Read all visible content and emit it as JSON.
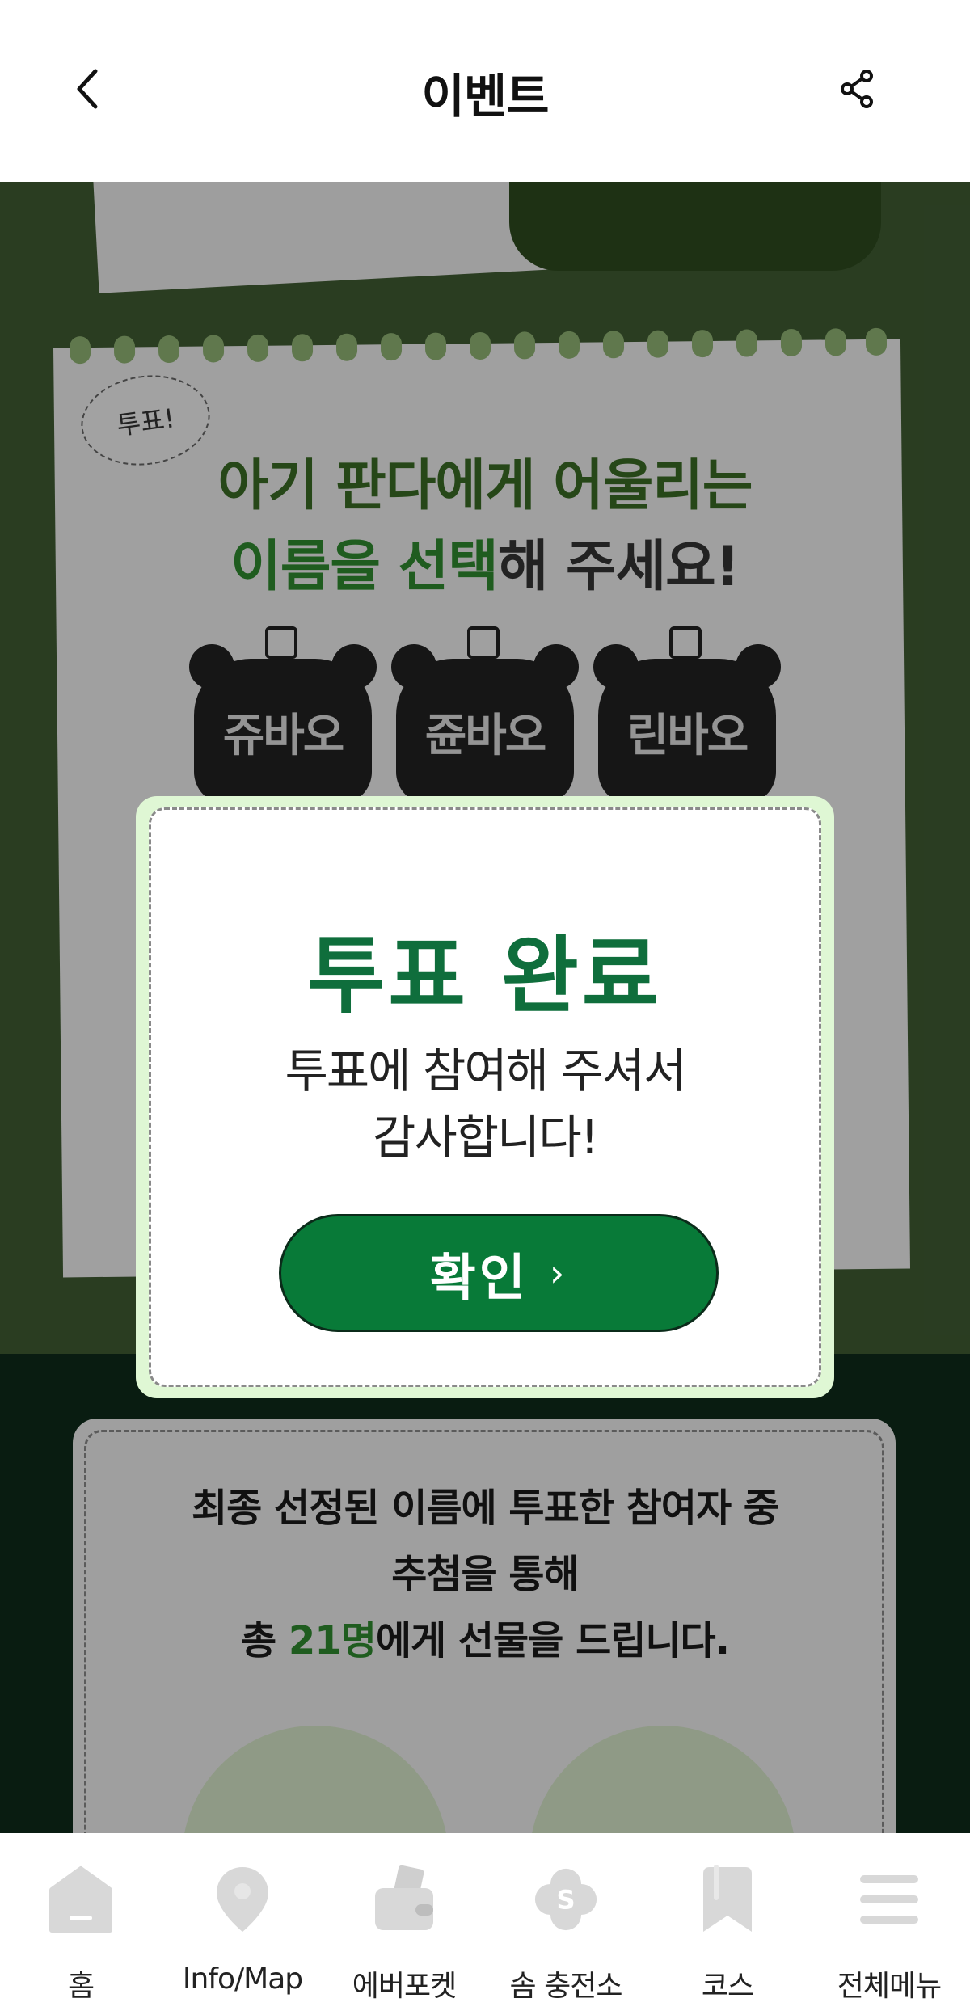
{
  "header": {
    "title": "이벤트"
  },
  "event": {
    "vote_bubble": "투표!",
    "headline_line1": "아기 판다에게 어울리는",
    "headline_line2_highlight": "이름을 선택",
    "headline_line2_rest": "해 주세요!",
    "candidates": [
      "쥬바오",
      "쥰바오",
      "린바오"
    ],
    "info_line1": "최종 선정된 이름에 투표한 참여자 중",
    "info_line2": "추첨을 통해",
    "info_line3_prefix": "총 ",
    "info_line3_highlight": "21명",
    "info_line3_suffix": "에게 선물을 드립니다."
  },
  "modal": {
    "title": "투표 완료",
    "message_line1": "투표에 참여해 주셔서",
    "message_line2": "감사합니다!",
    "confirm_label": "확인",
    "confirm_chevron": "›"
  },
  "bottom_nav": {
    "items": [
      {
        "label": "홈",
        "icon": "home-icon"
      },
      {
        "label": "Info/Map",
        "icon": "map-pin-icon"
      },
      {
        "label": "에버포켓",
        "icon": "wallet-icon"
      },
      {
        "label": "솜 충전소",
        "icon": "flower-coin-icon"
      },
      {
        "label": "코스",
        "icon": "bookmark-icon"
      },
      {
        "label": "전체메뉴",
        "icon": "menu-icon"
      }
    ]
  },
  "colors": {
    "accent_green": "#087a38",
    "title_green": "#0f6e3c",
    "modal_frame": "#dff7d4",
    "nav_icon": "#d8d8d8"
  }
}
